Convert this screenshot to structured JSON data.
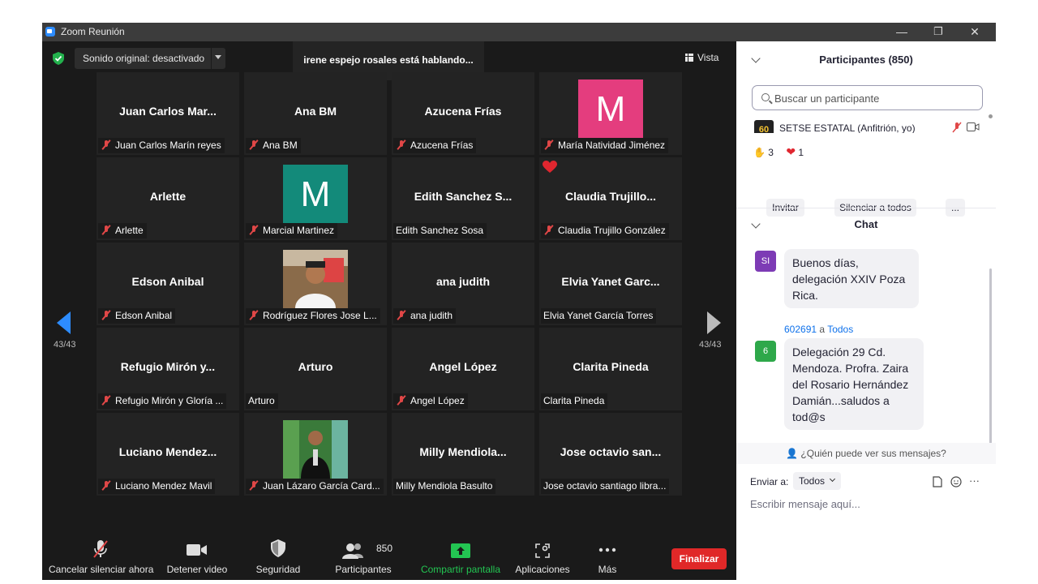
{
  "window": {
    "title": "Zoom Reunión",
    "minimize": "—",
    "maximize": "❐",
    "close": "✕"
  },
  "video": {
    "audio_label": "Sonido original: desactivado",
    "speaking": "irene espejo rosales está hablando...",
    "view_label": "Vista",
    "page_left": "43/43",
    "page_right": "43/43"
  },
  "tiles": [
    {
      "name": "Juan Carlos Mar...",
      "label": "Juan Carlos Marín reyes",
      "muted": true
    },
    {
      "name": "Ana BM",
      "label": "Ana BM",
      "muted": true
    },
    {
      "name": "Azucena Frías",
      "label": "Azucena Frías",
      "muted": true
    },
    {
      "name": "",
      "label": "María Natividad Jiménez",
      "muted": true,
      "avatar": "M",
      "avatar_color": "#e43d7e"
    },
    {
      "name": "Arlette",
      "label": "Arlette",
      "muted": true
    },
    {
      "name": "",
      "label": "Marcial Martinez",
      "muted": true,
      "avatar": "M",
      "avatar_color": "#138a7a"
    },
    {
      "name": "Edith Sanchez S...",
      "label": "Edith Sanchez Sosa",
      "muted": false
    },
    {
      "name": "Claudia Trujillo...",
      "label": "Claudia Trujillo González",
      "muted": true,
      "heart": true
    },
    {
      "name": "Edson Anibal",
      "label": "Edson Anibal",
      "muted": true
    },
    {
      "name": "",
      "label": "Rodríguez Flores Jose L...",
      "muted": true,
      "photo": "man-white-shirt"
    },
    {
      "name": "ana judith",
      "label": "ana judith",
      "muted": true
    },
    {
      "name": "Elvia Yanet Garc...",
      "label": "Elvia Yanet García Torres",
      "muted": false
    },
    {
      "name": "Refugio Mirón y...",
      "label": "Refugio Mirón y Gloría ...",
      "muted": true
    },
    {
      "name": "Arturo",
      "label": "Arturo",
      "muted": false
    },
    {
      "name": "Angel López",
      "label": "Angel López",
      "muted": true
    },
    {
      "name": "Clarita Pineda",
      "label": "Clarita Pineda",
      "muted": false
    },
    {
      "name": "Luciano Mendez...",
      "label": "Luciano Mendez Mavil",
      "muted": true
    },
    {
      "name": "",
      "label": "Juan Lázaro García Card...",
      "muted": true,
      "photo": "man-dark-suit"
    },
    {
      "name": "Milly Mendiola...",
      "label": "Milly Mendiola Basulto",
      "muted": false
    },
    {
      "name": "Jose octavio san...",
      "label": "Jose octavio santiago libra...",
      "muted": false
    }
  ],
  "toolbar": {
    "unmute": "Cancelar silenciar ahora",
    "video": "Detener video",
    "security": "Seguridad",
    "participants": "Participantes",
    "participants_count": "850",
    "share": "Compartir pantalla",
    "apps": "Aplicaciones",
    "more": "Más",
    "end": "Finalizar"
  },
  "participants_panel": {
    "title": "Participantes (850)",
    "search_placeholder": "Buscar un participante",
    "host_avatar": "60",
    "host_name": "SETSE ESTATAL (Anfitrión, yo)",
    "raise_hand_count": "3",
    "heart_count": "1",
    "invite": "Invitar",
    "mute_all": "Silenciar a todos",
    "more": "..."
  },
  "chat": {
    "title": "Chat",
    "messages": [
      {
        "avatar": "SI",
        "avatar_color": "#7d3bb5",
        "text": "Buenos días, delegación XXIV Poza Rica."
      },
      {
        "avatar": "6",
        "avatar_color": "#2ea84a",
        "sender": "602691",
        "to_word": "a",
        "to": "Todos",
        "text": "Delegación 29 Cd. Mendoza. Profra. Zaira del Rosario Hernández Damián...saludos a tod@s"
      }
    ],
    "who_can_see": "¿Quién puede ver sus mensajes?",
    "send_to_label": "Enviar a:",
    "send_to_value": "Todos",
    "compose_placeholder": "Escribir mensaje aquí...",
    "more": "···"
  }
}
